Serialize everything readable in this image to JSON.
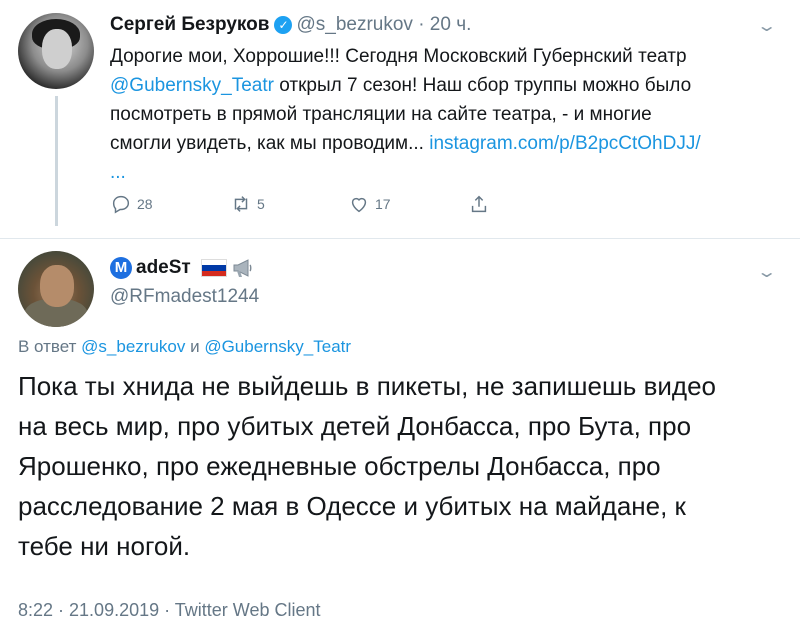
{
  "tweet1": {
    "name": "Сергей Безруков",
    "handle": "@s_bezrukov",
    "time": "· 20 ч.",
    "lines": [
      {
        "pre": "Дорогие мои, Хоррошие!!! Сегодня Московский Губернский театр",
        "link": "",
        "post": ""
      },
      {
        "pre": "",
        "link": "@Gubernsky_Teatr",
        "post": " открыл 7 сезон! Наш   сбор труппы можно было"
      },
      {
        "pre": "посмотреть в прямой трансляции на  сайте театра, - и многие",
        "link": "",
        "post": ""
      },
      {
        "pre": "смогли увидеть, как мы проводим... ",
        "link": "instagram.com/p/B2pcCtOhDJJ/",
        "post": ""
      },
      {
        "pre": "",
        "link": "...",
        "post": ""
      }
    ],
    "actions": {
      "replies": "28",
      "retweets": "5",
      "likes": "17"
    }
  },
  "tweet2": {
    "badge": "M",
    "name": "adeSт",
    "handle": "@RFmadest1244",
    "reply_prefix": "В ответ ",
    "reply_user1": "@s_bezrukov",
    "reply_and": " и ",
    "reply_user2": "@Gubernsky_Teatr",
    "lines": [
      "Пока ты хнида не выйдешь в пикеты, не запишешь видео",
      "на весь мир, про убитых детей Донбасса, про Бута, про",
      "Ярошенко, про ежедневные обстрелы Донбасса, про",
      "расследование 2 мая в Одессе и убитых на майдане, к",
      "тебе ни ногой."
    ],
    "meta": "8:22 · 21.09.2019 · Twitter Web Client"
  },
  "colors": {
    "link": "#1b95e0",
    "muted": "#657786",
    "verified": "#1da1f2"
  }
}
